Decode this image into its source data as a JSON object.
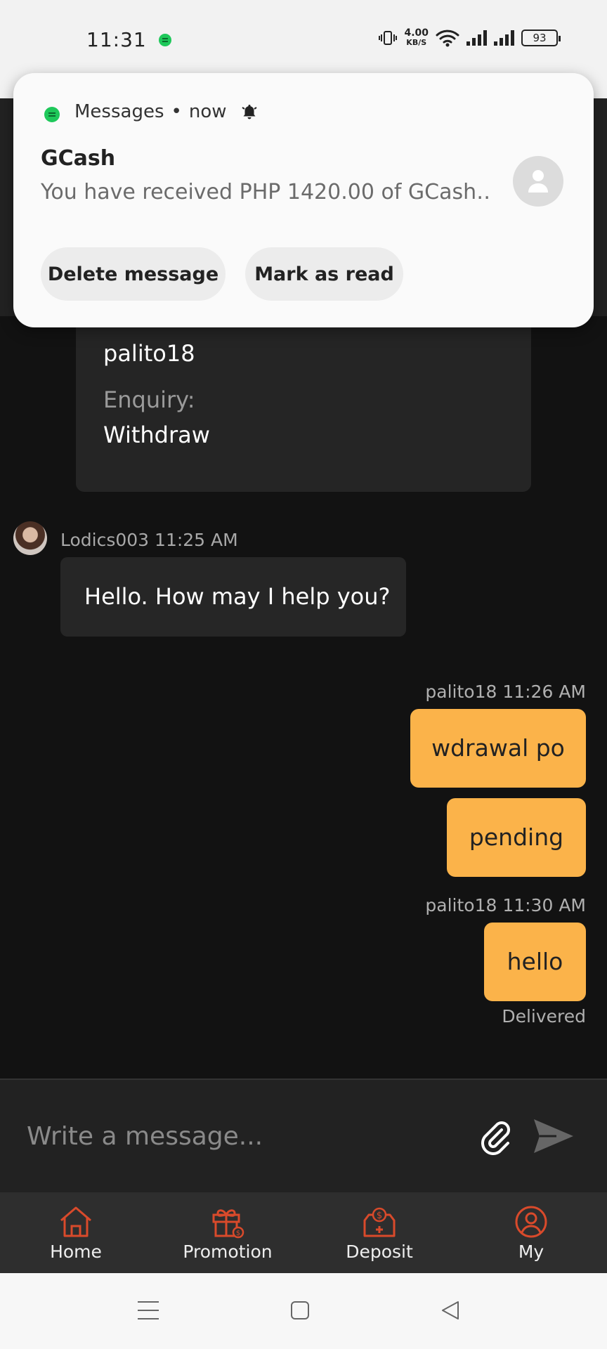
{
  "status_bar": {
    "time": "11:31",
    "net_speed": "4.00",
    "net_unit": "KB/S",
    "battery": "93"
  },
  "notification": {
    "app_name": "Messages",
    "when": "now",
    "title": "GCash",
    "body": "You have received PHP 1420.00 of GCash…",
    "actions": [
      "Delete message",
      "Mark as read"
    ]
  },
  "enquiry": {
    "user": "palito18",
    "label": "Enquiry:",
    "value": "Withdraw"
  },
  "messages": {
    "agent_meta": "Lodics003 11:25 AM",
    "agent_text": "Hello. How may I help you?",
    "user_meta_1": "palito18 11:26 AM",
    "user_text_1": "wdrawal po",
    "user_text_2": "pending",
    "user_meta_2": "palito18 11:30 AM",
    "user_text_3": "hello",
    "status": "Delivered"
  },
  "composer": {
    "placeholder": "Write a message..."
  },
  "bottom_nav": {
    "home": "Home",
    "promotion": "Promotion",
    "deposit": "Deposit",
    "my": "My",
    "accent": "#d94a2b"
  }
}
